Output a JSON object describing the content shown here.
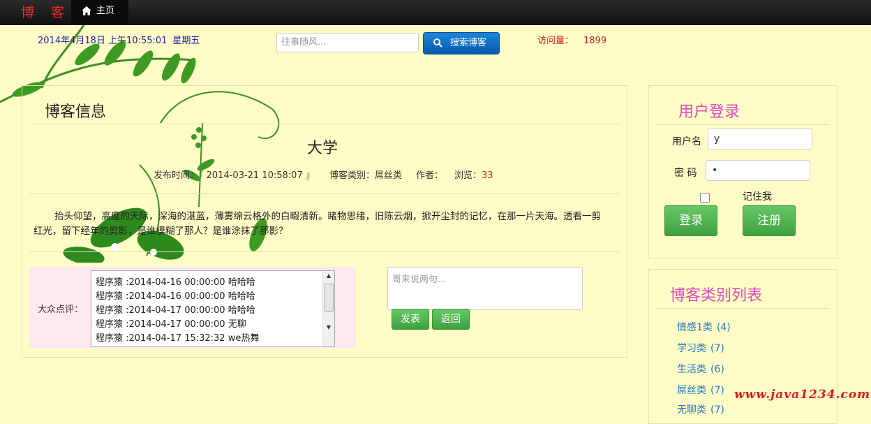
{
  "nav": {
    "brand": "博 客",
    "home_label": "主页"
  },
  "header": {
    "date": "2014年4月18日 上午10:55:01",
    "weekday": "星期五",
    "search_placeholder": "往事随风...",
    "search_button": "搜索博客",
    "visits_label": "访问量：",
    "visits_count": "1899"
  },
  "main": {
    "panel_title": "博客信息",
    "article": {
      "title": "大学",
      "publish_label": "发布时间：",
      "publish_time": "『 2014-03-21 10:58:07 』",
      "category": "博客类别：屌丝类",
      "author_label": "作者：",
      "views_label": "浏览：",
      "views_count": "33",
      "content": "抬头仰望，高度的天际，深海的湛蓝，薄雾绵云格外的白暇清新。睹物思绪，旧陈云烟，掀开尘封的记忆，在那一片天海。透看一剪红光，留下经年的剪影，是谁模糊了那人？是谁涂抹了那影？"
    },
    "comments": {
      "label": "大众点评：",
      "items": [
        "程序猿 :2014-04-16 00:00:00  哈哈哈",
        "程序猿 :2014-04-16 00:00:00  哈哈哈",
        "程序猿 :2014-04-17 00:00:00  哈哈哈",
        "程序猿 :2014-04-17 00:00:00  无聊",
        "程序猿 :2014-04-17 15:32:32  we热舞"
      ],
      "input_placeholder": "哥来说两句...",
      "submit_button": "发表",
      "back_button": "返回"
    }
  },
  "login": {
    "title": "用户登录",
    "username_label": "用户名",
    "username_value": "y",
    "password_label": "密 码",
    "password_value": "•",
    "remember_label": "记住我",
    "login_button": "登录",
    "register_button": "注册"
  },
  "categories": {
    "title": "博客类别列表",
    "items": [
      {
        "name": "情感1类",
        "count": "(4)"
      },
      {
        "name": "学习类",
        "count": "(7)"
      },
      {
        "name": "生活类",
        "count": "(6)"
      },
      {
        "name": "屌丝类",
        "count": "(7)"
      },
      {
        "name": "无聊类",
        "count": "(7)"
      }
    ]
  },
  "watermark": "www.java1234.com",
  "colors": {
    "background": "#fefcc6",
    "nav": "#1a1a1a",
    "accent_pink": "#e04bc1",
    "link_blue": "#2278c8",
    "green_button": "#4fb34f"
  }
}
